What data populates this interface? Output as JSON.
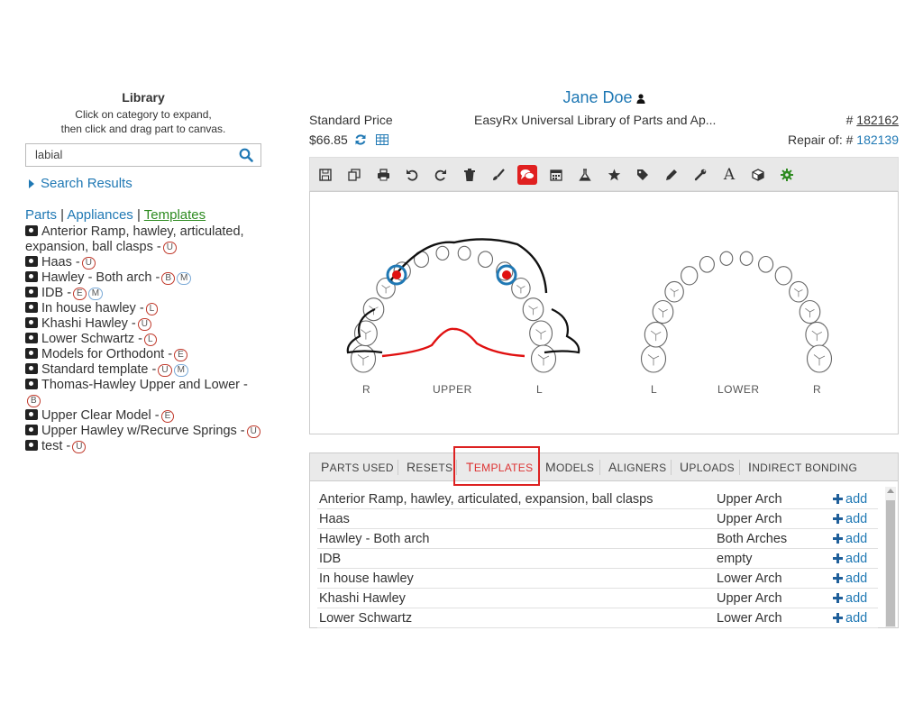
{
  "library": {
    "title": "Library",
    "subtitle_line1": "Click on category to expand,",
    "subtitle_line2": "then click and drag part to canvas.",
    "search_value": "labial",
    "search_results_label": "Search Results",
    "nav": {
      "parts": "Parts",
      "sep1": " | ",
      "appliances": "Appliances",
      "sep2": " | ",
      "templates": "Templates"
    },
    "items": [
      {
        "label": "Anterior Ramp, hawley, articulated, expansion, ball clasps -",
        "badges": [
          "U"
        ]
      },
      {
        "label": "Haas -",
        "badges": [
          "U"
        ]
      },
      {
        "label": "Hawley - Both arch -",
        "badges": [
          "B",
          "M"
        ]
      },
      {
        "label": "IDB -",
        "badges": [
          "E",
          "M"
        ]
      },
      {
        "label": "In house hawley -",
        "badges": [
          "L"
        ]
      },
      {
        "label": "Khashi Hawley -",
        "badges": [
          "U"
        ]
      },
      {
        "label": "Lower Schwartz -",
        "badges": [
          "L"
        ]
      },
      {
        "label": "Models for Orthodont -",
        "badges": [
          "E"
        ]
      },
      {
        "label": "Standard template -",
        "badges": [
          "U",
          "M"
        ]
      },
      {
        "label": "Thomas-Hawley Upper and Lower -",
        "badges": [
          "B"
        ]
      },
      {
        "label": "Upper Clear Model -",
        "badges": [
          "E"
        ]
      },
      {
        "label": "Upper Hawley w/Recurve Springs -",
        "badges": [
          "U"
        ]
      },
      {
        "label": "test -",
        "badges": [
          "U"
        ]
      }
    ]
  },
  "patient": {
    "name": "Jane Doe",
    "price_label": "Standard Price",
    "price": "$66.85",
    "library_name": "EasyRx Universal Library of Parts and Ap...",
    "case_prefix": "# ",
    "case_number": "182162",
    "repair_label": "Repair of: # ",
    "repair_number": "182139"
  },
  "toolbar": {
    "icons": [
      "save-icon",
      "copy-icon",
      "print-icon",
      "undo-icon",
      "redo-icon",
      "trash-icon",
      "brush-icon",
      "comments-icon",
      "calendar-icon",
      "flask-icon",
      "star-icon",
      "tag-icon",
      "pencil-icon",
      "wrench-icon",
      "text-icon",
      "cube-icon",
      "gear-icon"
    ],
    "active": "comments-icon"
  },
  "canvas": {
    "upper_label": "UPPER",
    "lower_label": "LOWER",
    "upper_r": "R",
    "upper_l": "L",
    "lower_l": "L",
    "lower_r": "R"
  },
  "bottom_tabs": [
    {
      "first": "P",
      "rest": "ARTS USED"
    },
    {
      "first": "R",
      "rest": "ESETS"
    },
    {
      "first": "T",
      "rest": "EMPLATES"
    },
    {
      "first": "M",
      "rest": "ODELS"
    },
    {
      "first": "A",
      "rest": "LIGNERS"
    },
    {
      "first": "U",
      "rest": "PLOADS"
    },
    {
      "first": "I",
      "rest": "NDIRECT BONDING"
    }
  ],
  "active_tab": "Templates",
  "templates": [
    {
      "name": "Anterior Ramp, hawley, articulated, expansion, ball clasps",
      "arch": "Upper Arch",
      "action": "add"
    },
    {
      "name": "Haas",
      "arch": "Upper Arch",
      "action": "add"
    },
    {
      "name": "Hawley - Both arch",
      "arch": "Both Arches",
      "action": "add"
    },
    {
      "name": "IDB",
      "arch": "empty",
      "action": "add"
    },
    {
      "name": "In house hawley",
      "arch": "Lower Arch",
      "action": "add"
    },
    {
      "name": "Khashi Hawley",
      "arch": "Upper Arch",
      "action": "add"
    },
    {
      "name": "Lower Schwartz",
      "arch": "Lower Arch",
      "action": "add"
    }
  ],
  "colors": {
    "link": "#1f78b4",
    "active_red": "#e02020",
    "wire_red": "#e01010",
    "templates_green": "#2e8b20"
  }
}
